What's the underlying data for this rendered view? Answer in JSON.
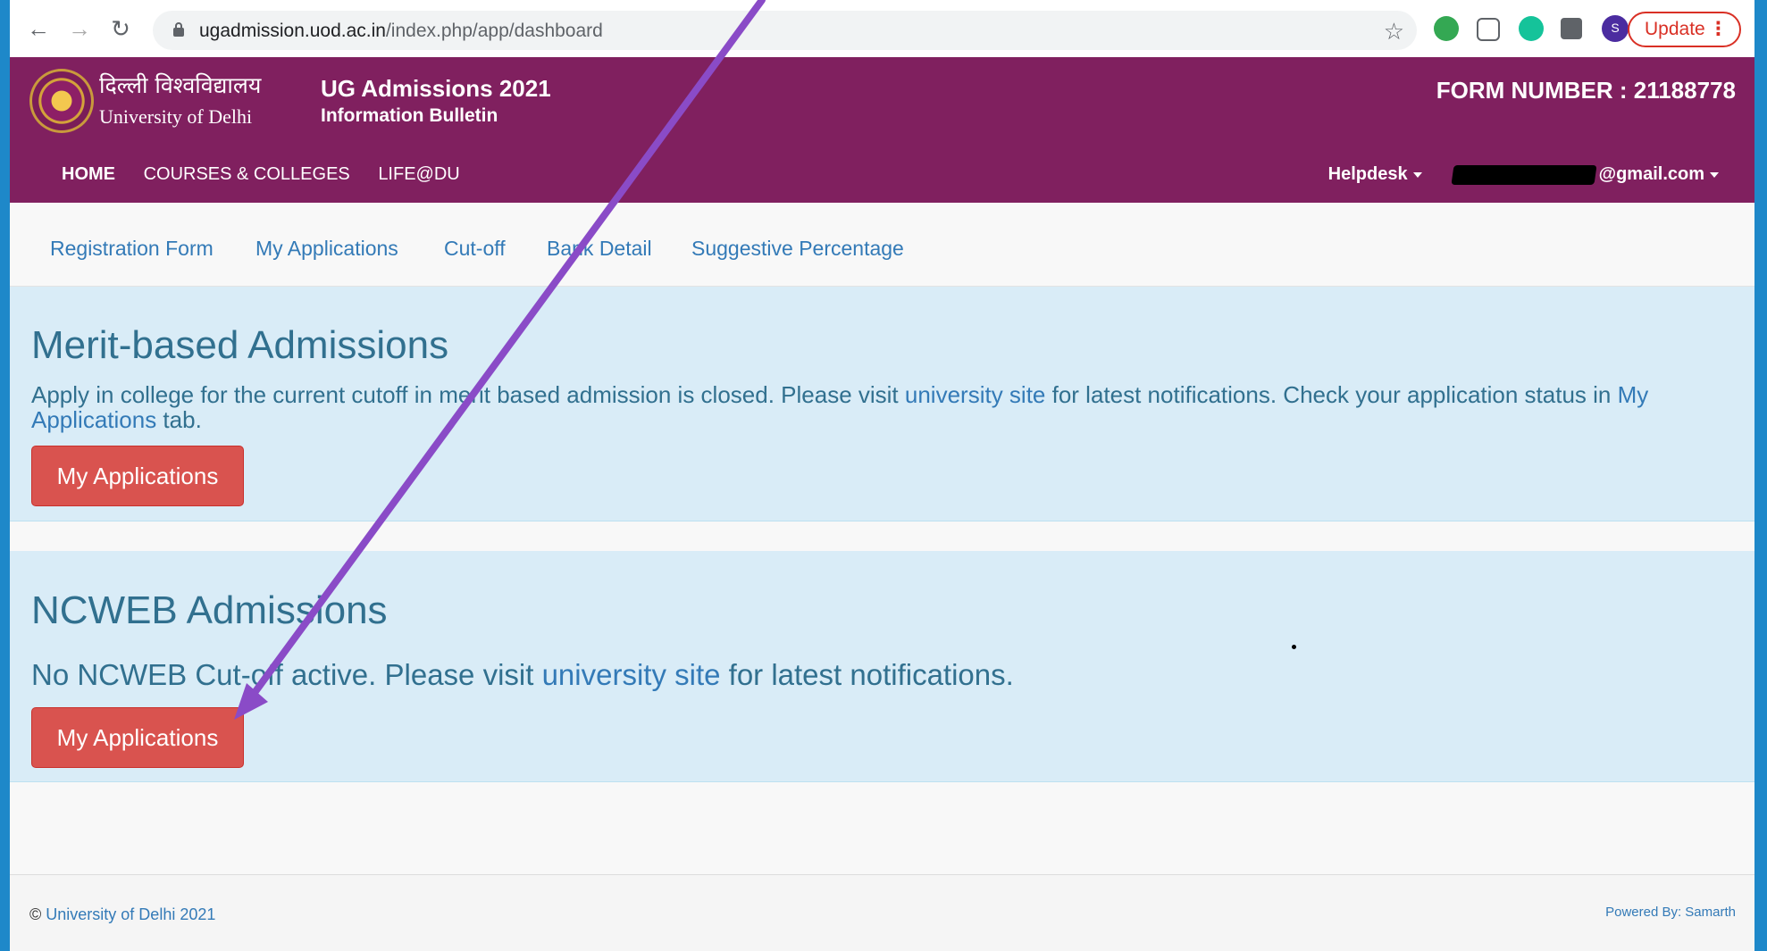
{
  "browser": {
    "url_host": "ugadmission.uod.ac.in",
    "url_path": "/index.php/app/dashboard",
    "profile_initial": "S",
    "update_label": "Update"
  },
  "header": {
    "university_hindi": "दिल्ली विश्वविद्यालय",
    "university_english": "University of Delhi",
    "title": "UG Admissions 2021",
    "subtitle": "Information Bulletin",
    "form_number": "FORM NUMBER : 21188778"
  },
  "main_nav": {
    "items": [
      "HOME",
      "COURSES & COLLEGES",
      "LIFE@DU"
    ],
    "helpdesk": "Helpdesk",
    "email_suffix": "@gmail.com"
  },
  "sub_nav": {
    "items": [
      "Registration Form",
      "My Applications",
      "Cut-off",
      "Bank Detail",
      "Suggestive Percentage"
    ]
  },
  "merit": {
    "title": "Merit-based Admissions",
    "text_1": "Apply in college for the current cutoff in merit based admission is closed. Please visit ",
    "link_1": "university site",
    "text_2": " for latest notifications. Check your application status in ",
    "link_2": "My Applications",
    "text_3": " tab.",
    "button": "My Applications"
  },
  "ncweb": {
    "title": "NCWEB Admissions",
    "text_1": "No NCWEB Cut-off active. Please visit ",
    "link_1": "university site",
    "text_2": " for latest notifications.",
    "button": "My Applications"
  },
  "footer": {
    "copyright_symbol": "©",
    "copyright_link": "University of Delhi 2021",
    "powered": "Powered By: Samarth"
  },
  "colors": {
    "header_bg": "#80205f",
    "panel_bg": "#d9ecf7",
    "button_red": "#d9534f",
    "link_blue": "#337ab7",
    "arrow_purple": "#8a4bc7"
  }
}
